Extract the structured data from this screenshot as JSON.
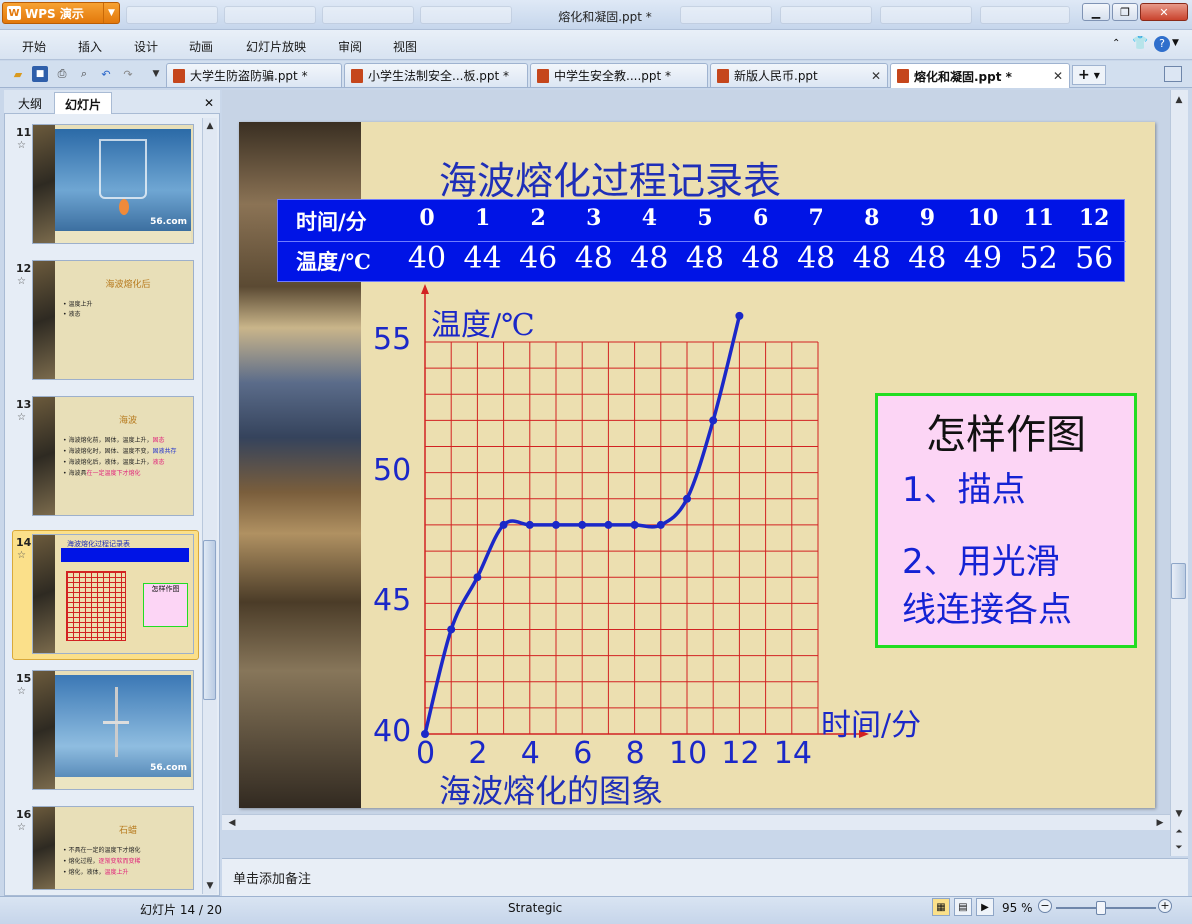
{
  "app": {
    "brand": "WPS 演示",
    "window_title": "熔化和凝固.ppt *"
  },
  "menu": [
    "开始",
    "插入",
    "设计",
    "动画",
    "幻灯片放映",
    "审阅",
    "视图"
  ],
  "doc_tabs": [
    {
      "label": "大学生防盗防骗.ppt *"
    },
    {
      "label": "小学生法制安全...板.ppt *"
    },
    {
      "label": "中学生安全教....ppt *"
    },
    {
      "label": "新版人民币.ppt"
    },
    {
      "label": "熔化和凝固.ppt *"
    }
  ],
  "panel": {
    "tab_outline": "大纲",
    "tab_slides": "幻灯片"
  },
  "thumbnails": {
    "s11": {
      "num": "11",
      "watermark": "56.com"
    },
    "s12": {
      "num": "12",
      "title": "海波熔化后",
      "lines": [
        "温度上升",
        "液态"
      ]
    },
    "s13": {
      "num": "13",
      "title": "海波",
      "lines": [
        {
          "text": "海波熔化前，固体，温度上升，",
          "hl": "固态"
        },
        {
          "text": "海波熔化时，固体、温度不变，",
          "hl": "固液共存"
        },
        {
          "text": "海波熔化后，液体，温度上升，",
          "hl": "液态"
        },
        {
          "text": "海波具",
          "hl": "在一定温度下才熔化"
        }
      ]
    },
    "s14": {
      "num": "14"
    },
    "s15": {
      "num": "15",
      "watermark": "56.com"
    },
    "s16": {
      "num": "16",
      "title": "石蜡",
      "lines": [
        {
          "text": "不具在一定的温度下才熔化",
          "hl": ""
        },
        {
          "text": "熔化过程，",
          "hl": "逐渐变软而变稀"
        },
        {
          "text": "熔化，液体，",
          "hl": "温度上升"
        }
      ]
    }
  },
  "slide": {
    "title": "海波熔化过程记录表",
    "table": {
      "time_label": "时间/分",
      "temp_label": "温度/℃",
      "times": [
        "0",
        "1",
        "2",
        "3",
        "4",
        "5",
        "6",
        "7",
        "8",
        "9",
        "10",
        "11",
        "12"
      ],
      "temps": [
        "40",
        "44",
        "46",
        "48",
        "48",
        "48",
        "48",
        "48",
        "48",
        "48",
        "49",
        "52",
        "56"
      ]
    },
    "y_axis_label": "温度/℃",
    "x_axis_label": "时间/分",
    "y_ticks": [
      "55",
      "50",
      "45",
      "40"
    ],
    "x_ticks": [
      "0",
      "2",
      "4",
      "6",
      "8",
      "10",
      "12",
      "14"
    ],
    "caption": "海波熔化的图象",
    "howto": {
      "title": "怎样作图",
      "step1": "1、描点",
      "step2a": "2、用光滑",
      "step2b": "线连接各点"
    }
  },
  "notes_placeholder": "单击添加备注",
  "status": {
    "slide_counter": "幻灯片 14 / 20",
    "theme": "Strategic",
    "zoom": "95 %"
  },
  "colors": {
    "slide_bg": "#ecdfb0",
    "table_bg": "#0014e6",
    "curve": "#1b28c8",
    "grid": "#d22222",
    "accent": "#e3780b"
  },
  "chart_data": {
    "type": "line",
    "x": [
      0,
      1,
      2,
      3,
      4,
      5,
      6,
      7,
      8,
      9,
      10,
      11,
      12
    ],
    "y": [
      40,
      44,
      46,
      48,
      48,
      48,
      48,
      48,
      48,
      48,
      49,
      52,
      56
    ],
    "xlabel": "时间/分",
    "ylabel": "温度/℃",
    "title": "海波熔化的图象",
    "xlim": [
      0,
      15
    ],
    "ylim": [
      40,
      55
    ]
  }
}
